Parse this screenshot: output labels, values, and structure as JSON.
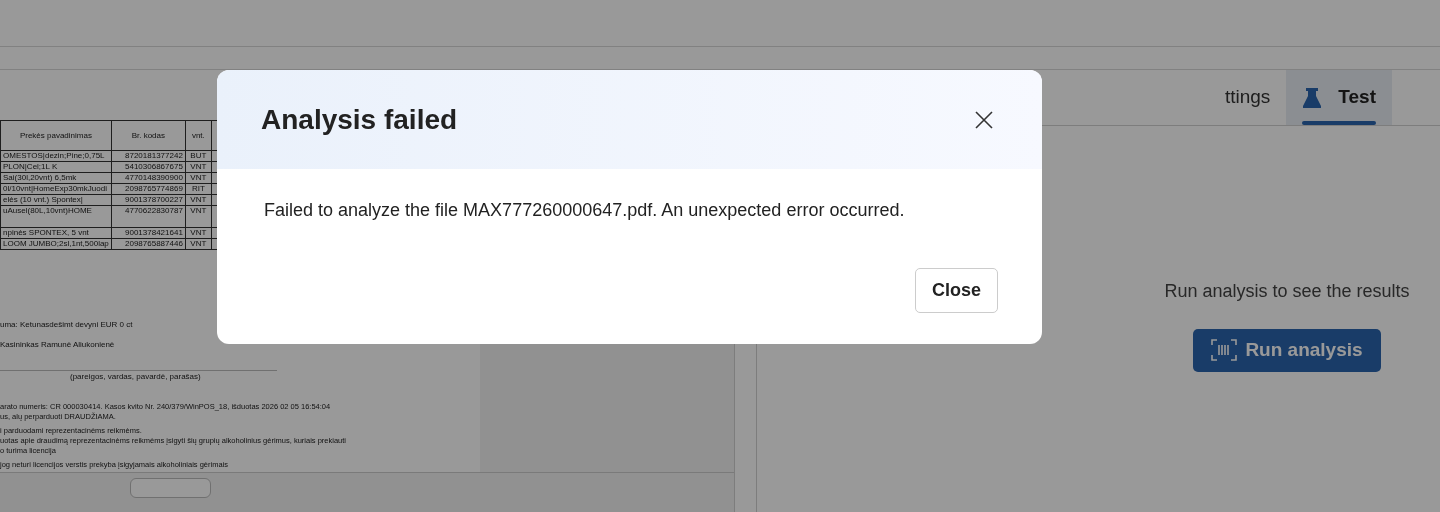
{
  "document": {
    "table": {
      "columns": [
        "Prekės pavadinimas",
        "Br. kodas",
        "vnt."
      ],
      "rows": [
        [
          "OMESTOS|dezin;Pine;0,75L",
          "8720181377242",
          "BUT"
        ],
        [
          "PLON|Cel;1L K",
          "5410306867675",
          "VNT"
        ],
        [
          "Sai(30l,20vnt) 6,5mk",
          "4770148390900",
          "VNT"
        ],
        [
          "0l/10vnt|HomeExp30mkJuodi",
          "2098765774869",
          "RIT"
        ],
        [
          "elės (10 vnt.) Spontex|",
          "9001378700227",
          "VNT"
        ],
        [
          "uAusel(80L,10vnt)HOME",
          "4770622830787",
          "VNT"
        ],
        [
          "npinės SPONTEX, 5 vnt",
          "9001378421641",
          "VNT"
        ],
        [
          "LOOM JUMBO;2sl,1nt,500lap",
          "2098765887446",
          "VNT"
        ]
      ]
    },
    "sum_line": "uma: Ketunasdešimt devyni EUR 0 ct",
    "cashier_line": "Kasininkas Ramunė Aliukonienė",
    "signature_caption": "(pareigos, vardas, pavardė, parašas)",
    "notes": [
      "arato numeris: CR 000030414. Kasos kvito Nr. 240/379/WinPOS_18, išduotas 2026 02 05 16:54:04",
      "us, alų perparduoti DRAUDŽIAMA.",
      "i parduodami reprezentacinėms reikmėms.",
      "uotas apie draudimą reprezentacinėms reikmėms įsigyti šių grupių alkoholinius gėrimus, kuriais prekiauti",
      "o turima licencija",
      "jog neturi licencijos verstis prekyba įsigyjamais alkoholiniais gėrimais"
    ]
  },
  "tabs": [
    {
      "label": "ttings",
      "selected": false
    },
    {
      "label": "Test",
      "selected": true
    }
  ],
  "results": {
    "message": "Run analysis to see the results",
    "button": "Run analysis"
  },
  "dialog": {
    "title": "Analysis failed",
    "message": "Failed to analyze the file MAX777260000647.pdf. An unexpected error occurred.",
    "button": "Close"
  }
}
